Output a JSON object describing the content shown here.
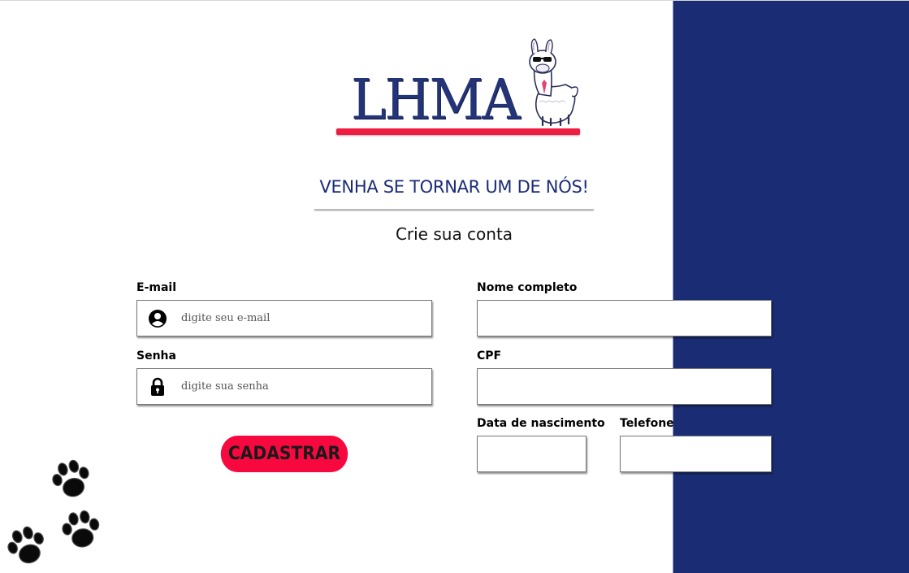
{
  "logo": {
    "text": "LHMA"
  },
  "headline": "VENHA SE TORNAR UM DE NÓS!",
  "subtitle": "Crie sua conta",
  "form": {
    "email": {
      "label": "E-mail",
      "placeholder": "digite seu e-mail",
      "value": ""
    },
    "password": {
      "label": "Senha",
      "placeholder": "digite sua senha",
      "value": ""
    },
    "full_name": {
      "label": "Nome completo",
      "value": ""
    },
    "cpf": {
      "label": "CPF",
      "value": ""
    },
    "birth_date": {
      "label": "Data de nascimento",
      "value": ""
    },
    "phone": {
      "label": "Telefone",
      "value": ""
    },
    "submit_label": "CADASTRAR"
  },
  "icons": {
    "email_field": "user-circle-icon",
    "password_field": "lock-icon",
    "decoration": "paw-print-icon",
    "logo_mascot": "llama-icon"
  },
  "colors": {
    "brand_blue": "#1a2d74",
    "accent_red": "#f7093f",
    "headline_blue": "#1b2c78"
  }
}
